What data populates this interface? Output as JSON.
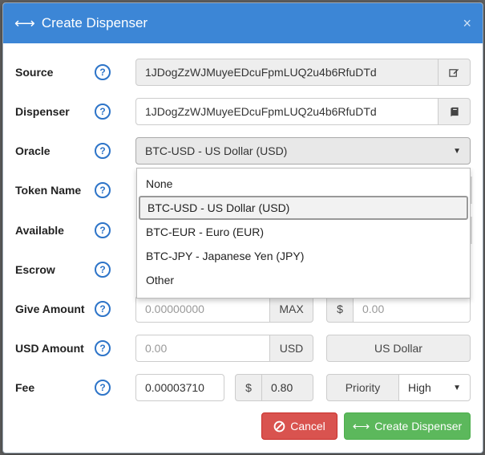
{
  "modal": {
    "title": "Create Dispenser",
    "close": "×",
    "swap_icon": "⟷"
  },
  "fields": {
    "source": {
      "label": "Source",
      "value": "1JDogZzWJMuyeEDcuFpmLUQ2u4b6RfuDTd"
    },
    "dispenser": {
      "label": "Dispenser",
      "value": "1JDogZzWJMuyeEDcuFpmLUQ2u4b6RfuDTd"
    },
    "oracle": {
      "label": "Oracle",
      "value": "BTC-USD - US Dollar (USD)"
    },
    "token_name": {
      "label": "Token Name"
    },
    "available": {
      "label": "Available"
    },
    "escrow": {
      "label": "Escrow"
    },
    "give_amount": {
      "label": "Give Amount",
      "placeholder": "0.00000000",
      "max_label": "MAX",
      "currency_symbol": "$",
      "usd_placeholder": "0.00"
    },
    "usd_amount": {
      "label": "USD Amount",
      "placeholder": "0.00",
      "addon": "USD",
      "currency_button": "US Dollar"
    },
    "fee": {
      "label": "Fee",
      "value": "0.00003710",
      "currency_symbol": "$",
      "usd_value": "0.80",
      "priority_label": "Priority",
      "priority_value": "High"
    }
  },
  "help_glyph": "?",
  "oracle_options": [
    {
      "label": "None",
      "selected": false
    },
    {
      "label": "BTC-USD - US Dollar (USD)",
      "selected": true
    },
    {
      "label": "BTC-EUR - Euro (EUR)",
      "selected": false
    },
    {
      "label": "BTC-JPY - Japanese Yen (JPY)",
      "selected": false
    },
    {
      "label": "Other",
      "selected": false
    }
  ],
  "footer": {
    "cancel_label": "Cancel",
    "create_label": "Create Dispenser"
  },
  "colors": {
    "header": "#3c86d6",
    "help": "#2d74c8",
    "cancel": "#d9534f",
    "create": "#5cb85c"
  }
}
